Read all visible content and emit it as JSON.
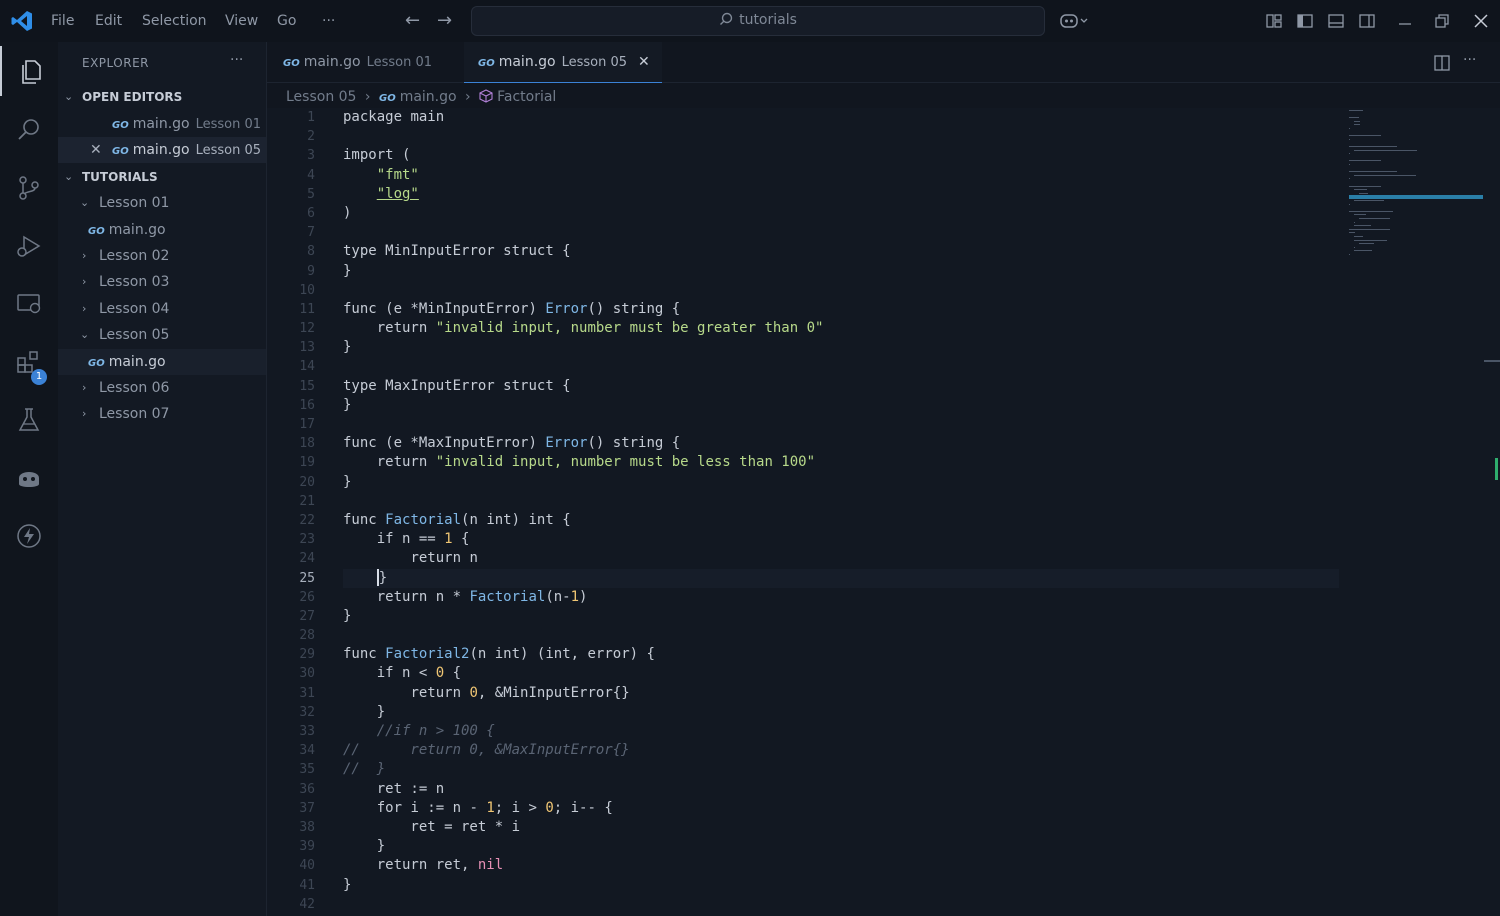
{
  "titlebar": {
    "menus": [
      "File",
      "Edit",
      "Selection",
      "View",
      "Go"
    ],
    "more_label": "···",
    "search_label": "tutorials"
  },
  "activity": {
    "extensions_badge": "1"
  },
  "explorer": {
    "title": "EXPLORER",
    "more_label": "···",
    "open_editors_label": "OPEN EDITORS",
    "open_editors": [
      {
        "file": "main.go",
        "folder": "Lesson 01"
      },
      {
        "file": "main.go",
        "folder": "Lesson 05"
      }
    ],
    "workspace_label": "TUTORIALS",
    "tree": [
      {
        "label": "Lesson 01",
        "expanded": true
      },
      {
        "label": "main.go"
      },
      {
        "label": "Lesson 02",
        "expanded": false
      },
      {
        "label": "Lesson 03",
        "expanded": false
      },
      {
        "label": "Lesson 04",
        "expanded": false
      },
      {
        "label": "Lesson 05",
        "expanded": true
      },
      {
        "label": "main.go"
      },
      {
        "label": "Lesson 06",
        "expanded": false
      },
      {
        "label": "Lesson 07",
        "expanded": false
      }
    ]
  },
  "tabs": [
    {
      "file": "main.go",
      "folder": "Lesson 01"
    },
    {
      "file": "main.go",
      "folder": "Lesson 05"
    }
  ],
  "go_badge": "GO",
  "breadcrumb": {
    "folder": "Lesson 05",
    "file": "main.go",
    "symbol": "Factorial"
  },
  "editor": {
    "current_line": 25,
    "line_numbers": [
      "1",
      "2",
      "3",
      "4",
      "5",
      "6",
      "7",
      "8",
      "9",
      "10",
      "11",
      "12",
      "13",
      "14",
      "15",
      "16",
      "17",
      "18",
      "19",
      "20",
      "21",
      "22",
      "23",
      "24",
      "25",
      "26",
      "27",
      "28",
      "29",
      "30",
      "31",
      "32",
      "33",
      "34",
      "35",
      "36",
      "37",
      "38",
      "39",
      "40",
      "41",
      "42"
    ]
  },
  "colors": {
    "accent": "#3b82d6",
    "background": "#121822",
    "string": "#b7d98a",
    "function": "#7fb7e6",
    "number": "#f0c674"
  }
}
